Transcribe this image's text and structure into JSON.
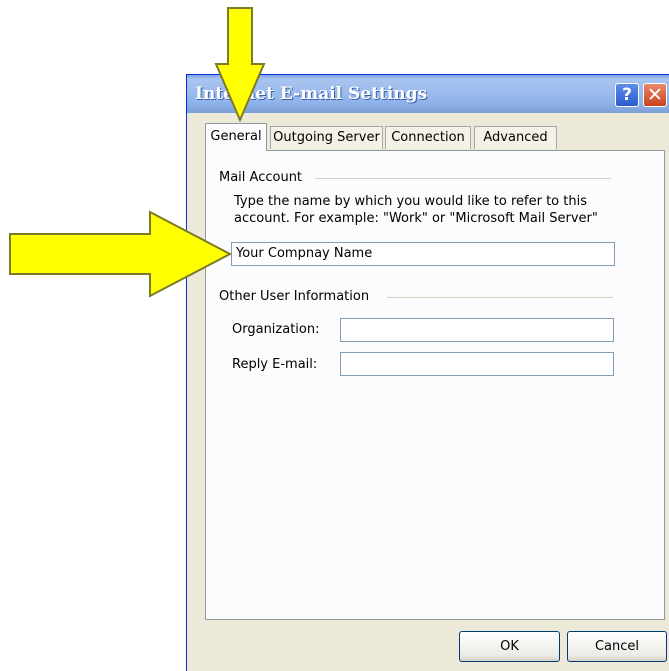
{
  "window": {
    "title": "Internet E-mail Settings",
    "help_label": "?",
    "close_label": "✕"
  },
  "tabs": [
    {
      "label": "General",
      "selected": true
    },
    {
      "label": "Outgoing Server"
    },
    {
      "label": "Connection"
    },
    {
      "label": "Advanced"
    }
  ],
  "mail_account": {
    "heading": "Mail Account",
    "description_line1": "Type the name by which you would like to refer to this",
    "description_line2": "account.  For example: \"Work\" or \"Microsoft Mail Server\"",
    "account_name_value": "Your Compnay Name"
  },
  "other_user": {
    "heading": "Other User Information",
    "organization_label": "Organization:",
    "organization_value": "",
    "reply_email_label": "Reply E-mail:",
    "reply_email_value": ""
  },
  "buttons": {
    "ok": "OK",
    "cancel": "Cancel"
  },
  "colors": {
    "arrow_fill": "#ffff00",
    "arrow_outline": "#7a7a2a"
  }
}
